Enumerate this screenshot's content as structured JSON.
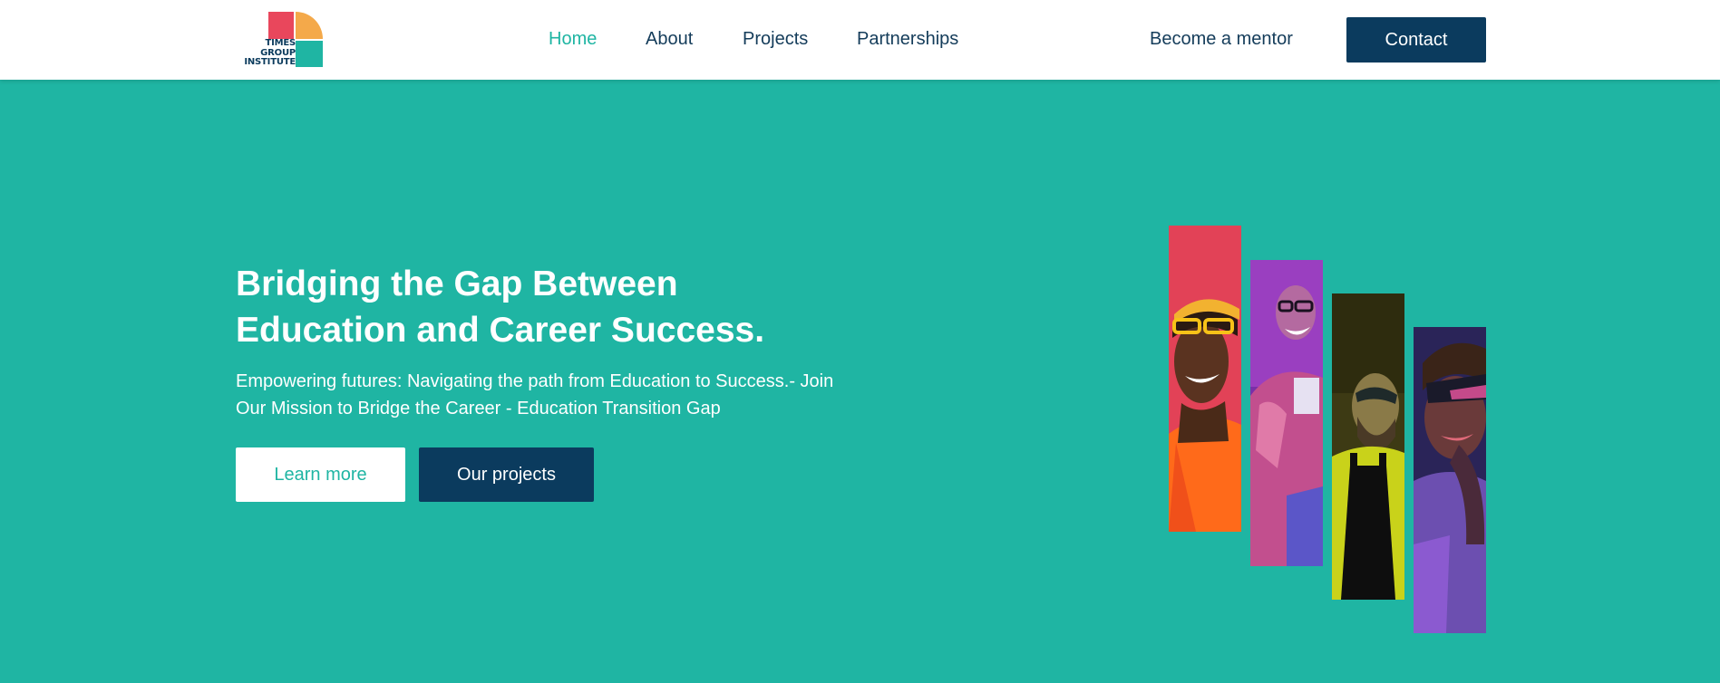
{
  "brand": {
    "logo_lines": [
      "TIMES",
      "GROUP",
      "INSTITUTE"
    ],
    "colors": {
      "red": "#e9475c",
      "orange": "#f4a94a",
      "teal": "#1fb5a3",
      "navy": "#0b3b5e"
    }
  },
  "nav": {
    "items": [
      {
        "label": "Home",
        "active": true
      },
      {
        "label": "About",
        "active": false
      },
      {
        "label": "Projects",
        "active": false
      },
      {
        "label": "Partnerships",
        "active": false
      }
    ],
    "mentor_label": "Become a mentor",
    "contact_label": "Contact"
  },
  "hero": {
    "title_line1": "Bridging the Gap Between",
    "title_line2": "Education and Career Success.",
    "subtitle_line1": "Empowering futures: Navigating the path from Education to Success.- Join",
    "subtitle_line2": "Our Mission to Bridge the Career - Education Transition Gap",
    "learn_more_label": "Learn more",
    "our_projects_label": "Our projects",
    "background_color": "#1fb5a3"
  },
  "photos": [
    {
      "name": "smiling-woman-orange-jacket-photo",
      "bg": "#e24257"
    },
    {
      "name": "laughing-woman-purple-light-photo",
      "bg": "#7a2fa8"
    },
    {
      "name": "bearded-man-yellow-sweater-photo",
      "bg": "#3d3a14"
    },
    {
      "name": "man-sunglasses-neon-light-photo",
      "bg": "#2a2458"
    }
  ]
}
